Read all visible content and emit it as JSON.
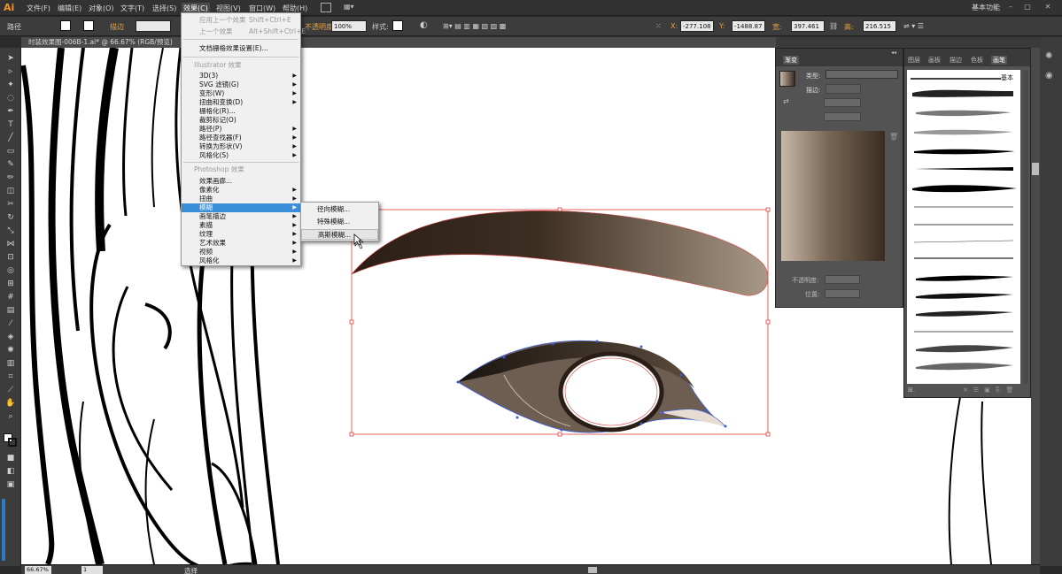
{
  "app": {
    "logo": "Ai",
    "workspace": "基本功能"
  },
  "menubar": {
    "items": [
      "文件(F)",
      "编辑(E)",
      "对象(O)",
      "文字(T)",
      "选择(S)",
      "效果(C)",
      "视图(V)",
      "窗口(W)",
      "帮助(H)"
    ]
  },
  "control": {
    "path_label": "路径",
    "stroke_label": "描边",
    "opacity_label": "不透明度",
    "opacity_value": "100%",
    "style_label": "样式:",
    "x_label": "X:",
    "x_value": "-277.108",
    "y_label": "Y:",
    "y_value": "-1488.87",
    "w_label": "宽:",
    "w_value": "397.461",
    "h_label": "高:",
    "h_value": "216.515"
  },
  "document": {
    "tab_title": "时装效果图-006B-1.ai* @ 66.67% (RGB/预览)"
  },
  "status": {
    "zoom": "66.67%",
    "page": "1",
    "tool": "选择"
  },
  "effect_menu": {
    "apply_last": "应用上一个效果",
    "apply_last_sc": "Shift+Ctrl+E",
    "last": "上一个效果",
    "last_sc": "Alt+Shift+Ctrl+E",
    "raster_settings": "文档栅格效果设置(E)...",
    "illustrator_section": "Illustrator 效果",
    "ill_items": [
      "3D(3)",
      "SVG 滤镜(G)",
      "变形(W)",
      "扭曲和变换(D)",
      "栅格化(R)...",
      "裁剪标记(O)",
      "路径(P)",
      "路径查找器(F)",
      "转换为形状(V)",
      "风格化(S)"
    ],
    "photoshop_section": "Photoshop 效果",
    "ps_items": [
      "效果画廊...",
      "像素化",
      "扭曲",
      "模糊",
      "画笔描边",
      "素描",
      "纹理",
      "艺术效果",
      "视频",
      "风格化"
    ]
  },
  "blur_submenu": {
    "items": [
      "径向模糊...",
      "特殊模糊...",
      "高斯模糊..."
    ]
  },
  "gradient_panel": {
    "title": "渐变",
    "type_label": "类型:",
    "stroke_label": "描边:",
    "opacity_label": "不透明度:",
    "position_label": "位置:"
  },
  "brush_panel": {
    "tabs": [
      "图层",
      "画板",
      "描边",
      "色板",
      "画笔"
    ],
    "basic_label": "基本"
  },
  "colors": {
    "accent": "#3a8fd8",
    "ai_orange": "#f7931e",
    "selection": "#e03c3c",
    "path_blue": "#3a5cd8"
  }
}
